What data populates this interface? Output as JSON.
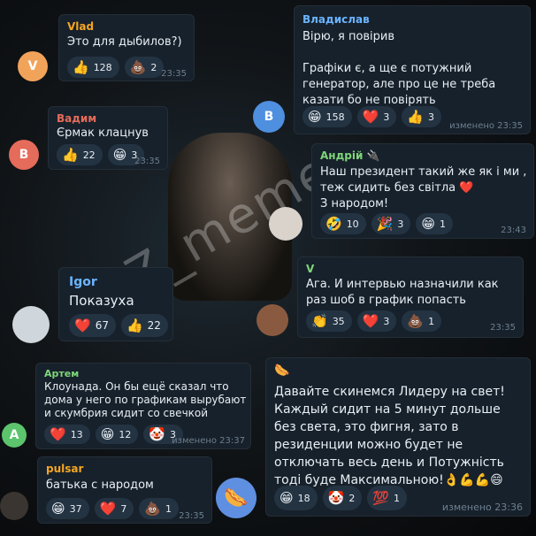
{
  "watermark": "tg:Z_memes",
  "colors": {
    "accent_green": "#7fd67a",
    "accent_blue": "#6ab4ff",
    "accent_orange": "#f5a623",
    "card_bg": "#17212b"
  },
  "messages": [
    {
      "author": "Vlad",
      "avatar_letter": "V",
      "text": "Это для дыбилов?)",
      "reactions": [
        {
          "icon": "thumbs-up",
          "glyph": "👍",
          "count": "128"
        },
        {
          "icon": "poop",
          "glyph": "💩",
          "count": "2"
        }
      ],
      "time": "23:35"
    },
    {
      "author": "Владислав",
      "avatar_letter": "В",
      "text": "Вірю, я повірив\n\nГрафіки є, а ще є потужний генератор, але про це не треба казати бо не повірять",
      "reactions": [
        {
          "icon": "grin",
          "glyph": "😁",
          "count": "158"
        },
        {
          "icon": "heart",
          "glyph": "❤️",
          "count": "3"
        },
        {
          "icon": "thumbs-up",
          "glyph": "👍",
          "count": "3"
        }
      ],
      "time": "изменено 23:35"
    },
    {
      "author": "Вадим",
      "avatar_letter": "В",
      "text": "Єрмак клацнув",
      "reactions": [
        {
          "icon": "thumbs-up",
          "glyph": "👍",
          "count": "22"
        },
        {
          "icon": "grin",
          "glyph": "😁",
          "count": "3"
        }
      ],
      "time": "23:35"
    },
    {
      "author": "Андрій 🔌",
      "text": "Наш президент такий же як і ми , теж сидить без світла ❤️\nЗ народом!",
      "reactions": [
        {
          "icon": "rofl",
          "glyph": "🤣",
          "count": "10"
        },
        {
          "icon": "confetti",
          "glyph": "🎉",
          "count": "3"
        },
        {
          "icon": "grin",
          "glyph": "😁",
          "count": "1"
        }
      ],
      "time": "23:43"
    },
    {
      "author": "Igor",
      "text": "Показуха",
      "reactions": [
        {
          "icon": "heart",
          "glyph": "❤️",
          "count": "67"
        },
        {
          "icon": "thumbs-up",
          "glyph": "👍",
          "count": "22"
        }
      ]
    },
    {
      "author": "V",
      "text": "Ага. И интервью назначили как раз шоб в график попасть",
      "reactions": [
        {
          "icon": "clap",
          "glyph": "👏",
          "count": "35"
        },
        {
          "icon": "heart",
          "glyph": "❤️",
          "count": "3"
        },
        {
          "icon": "poop",
          "glyph": "💩",
          "count": "1"
        }
      ],
      "time": "23:35"
    },
    {
      "author": "Артем",
      "avatar_letter": "A",
      "text": "Клоунада. Он бы ещё сказал что дома у него по графикам вырубают и скумбрия сидит со свечкой",
      "reactions": [
        {
          "icon": "heart",
          "glyph": "❤️",
          "count": "13"
        },
        {
          "icon": "grin",
          "glyph": "😁",
          "count": "12"
        },
        {
          "icon": "clown",
          "glyph": "🤡",
          "count": "3"
        }
      ],
      "time": "изменено 23:37"
    },
    {
      "author": "",
      "text": "Давайте скинемся Лидеру на свет! Каждый сидит на 5 минут дольше без света, это фигня, зато в резиденции можно будет не отключать весь день и Потужність тоді буде Максимальною!👌💪💪😄",
      "reactions": [
        {
          "icon": "grin",
          "glyph": "😁",
          "count": "18"
        },
        {
          "icon": "clown",
          "glyph": "🤡",
          "count": "2"
        },
        {
          "icon": "hundred",
          "glyph": "💯",
          "count": "1"
        }
      ],
      "time": "изменено 23:36"
    },
    {
      "author": "pulsar",
      "text": "батька с народом",
      "reactions": [
        {
          "icon": "grin",
          "glyph": "😁",
          "count": "37"
        },
        {
          "icon": "heart",
          "glyph": "❤️",
          "count": "7"
        },
        {
          "icon": "poop",
          "glyph": "💩",
          "count": "1"
        }
      ],
      "time": "23:35"
    }
  ]
}
